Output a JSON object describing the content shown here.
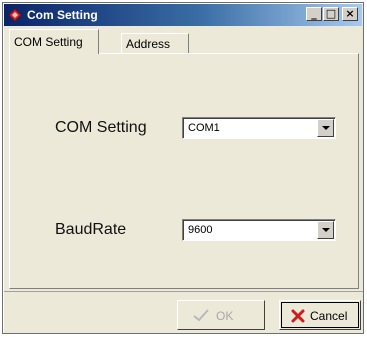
{
  "window": {
    "title": "Com Setting",
    "buttons": {
      "minimize": "_",
      "maximize": "□",
      "close": "×"
    }
  },
  "tabs": [
    {
      "label": "COM Setting",
      "active": true
    },
    {
      "label": "Address",
      "active": false
    }
  ],
  "form": {
    "com_label": "COM Setting",
    "com_value": "COM1",
    "baud_label": "BaudRate",
    "baud_value": "9600"
  },
  "actions": {
    "ok_label": "OK",
    "ok_enabled": false,
    "cancel_label": "Cancel"
  },
  "icons": {
    "app": "diamond-app-icon",
    "ok": "checkmark-icon",
    "cancel": "red-x-icon",
    "dropdown": "triangle-down-icon"
  },
  "colors": {
    "title_bar_start": "#0a246a",
    "title_bar_end": "#a6caf0",
    "app_icon": "#d2232a",
    "cancel_icon": "#d11a1a",
    "disabled_text": "#a8a8a8"
  }
}
